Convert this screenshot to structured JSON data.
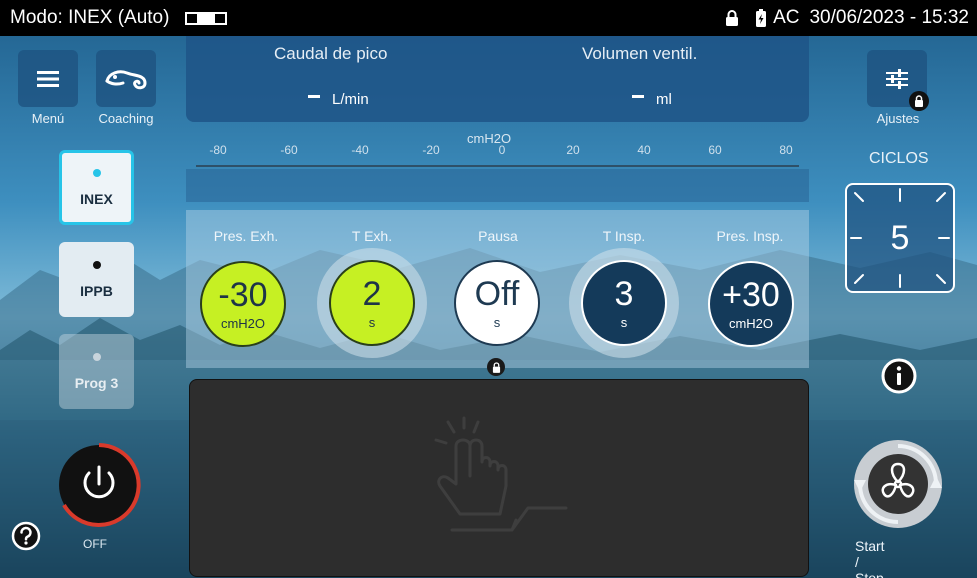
{
  "status_bar": {
    "mode": "Modo: INEX (Auto)",
    "power_source": "AC",
    "datetime": "30/06/2023 - 15:32"
  },
  "top_left": {
    "menu_label": "Menú",
    "coaching_label": "Coaching"
  },
  "top_right": {
    "settings_label": "Ajustes"
  },
  "measurements": {
    "peak_flow_label": "Caudal de pico",
    "peak_flow_unit": "L/min",
    "volume_label": "Volumen ventil.",
    "volume_unit": "ml"
  },
  "scale": {
    "unit": "cmH2O",
    "ticks": [
      "-80",
      "-60",
      "-40",
      "-20",
      "0",
      "20",
      "40",
      "60",
      "80"
    ]
  },
  "parameters": [
    {
      "label": "Pres. Exh.",
      "value": "-30",
      "unit": "cmH2O",
      "style": "lime"
    },
    {
      "label": "T Exh.",
      "value": "2",
      "unit": "s",
      "style": "lime"
    },
    {
      "label": "Pausa",
      "value": "Off",
      "unit": "s",
      "style": "white"
    },
    {
      "label": "T Insp.",
      "value": "3",
      "unit": "s",
      "style": "navy"
    },
    {
      "label": "Pres. Insp.",
      "value": "+30",
      "unit": "cmH2O",
      "style": "navy"
    }
  ],
  "modes": [
    {
      "label": "INEX",
      "selected": true
    },
    {
      "label": "IPPB",
      "selected": false
    },
    {
      "label": "Prog 3",
      "selected": false,
      "disabled": true
    }
  ],
  "cycles": {
    "label": "CICLOS",
    "value": "5"
  },
  "power": {
    "state_label": "OFF"
  },
  "start_stop_label": "Start / Stop",
  "colors": {
    "accent_lime": "#c6f023",
    "navy": "#143a5a",
    "selected_mode_border": "#27c4e8",
    "power_ring": "#d93a2b"
  }
}
